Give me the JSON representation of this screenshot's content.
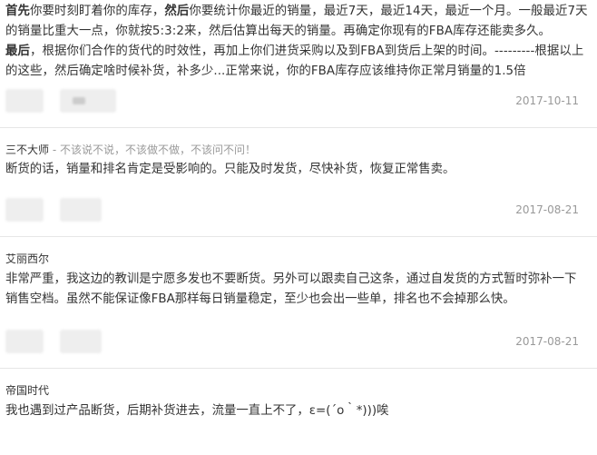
{
  "answer": {
    "segments": [
      {
        "t": "首先",
        "bold": true
      },
      {
        "t": "你要时刻盯着你的库存，",
        "bold": false
      },
      {
        "t": "然后",
        "bold": true
      },
      {
        "t": "你要统计你最近的销量，最近7天，最近14天，最近一个月。一般最近7天的销量比重大一点，你就按5:3:2来，然后估算出每天的销量。再确定你现有的FBA库存还能卖多久。",
        "bold": false
      },
      {
        "t": "最后",
        "bold": true
      },
      {
        "t": "，根据你们合作的货代的时效性，再加上你们进货采购以及到FBA到货后上架的时间。---------根据以上的这些，然后确定啥时候补货，补多少...正常来说，你的FBA库存应该维持你正常月销量的1.5倍",
        "bold": false
      }
    ],
    "date": "2017-10-11"
  },
  "comments": [
    {
      "author": "三不大师",
      "signature": " - 不该说不说，不该做不做，不该问不问！",
      "text": "断货的话，销量和排名肯定是受影响的。只能及时发货，尽快补货，恢复正常售卖。",
      "date": "2017-08-21"
    },
    {
      "author": "艾丽西尔",
      "signature": "",
      "text": "非常严重，我这边的教训是宁愿多发也不要断货。另外可以跟卖自己这条，通过自发货的方式暂时弥补一下销售空档。虽然不能保证像FBA那样每日销量稳定，至少也会出一些单，排名也不会掉那么快。",
      "date": "2017-08-21"
    },
    {
      "author": "帝国时代",
      "signature": "",
      "text": "我也遇到过产品断货，后期补货进去，流量一直上不了，ε=(´ο｀*)))唉",
      "date": ""
    }
  ]
}
